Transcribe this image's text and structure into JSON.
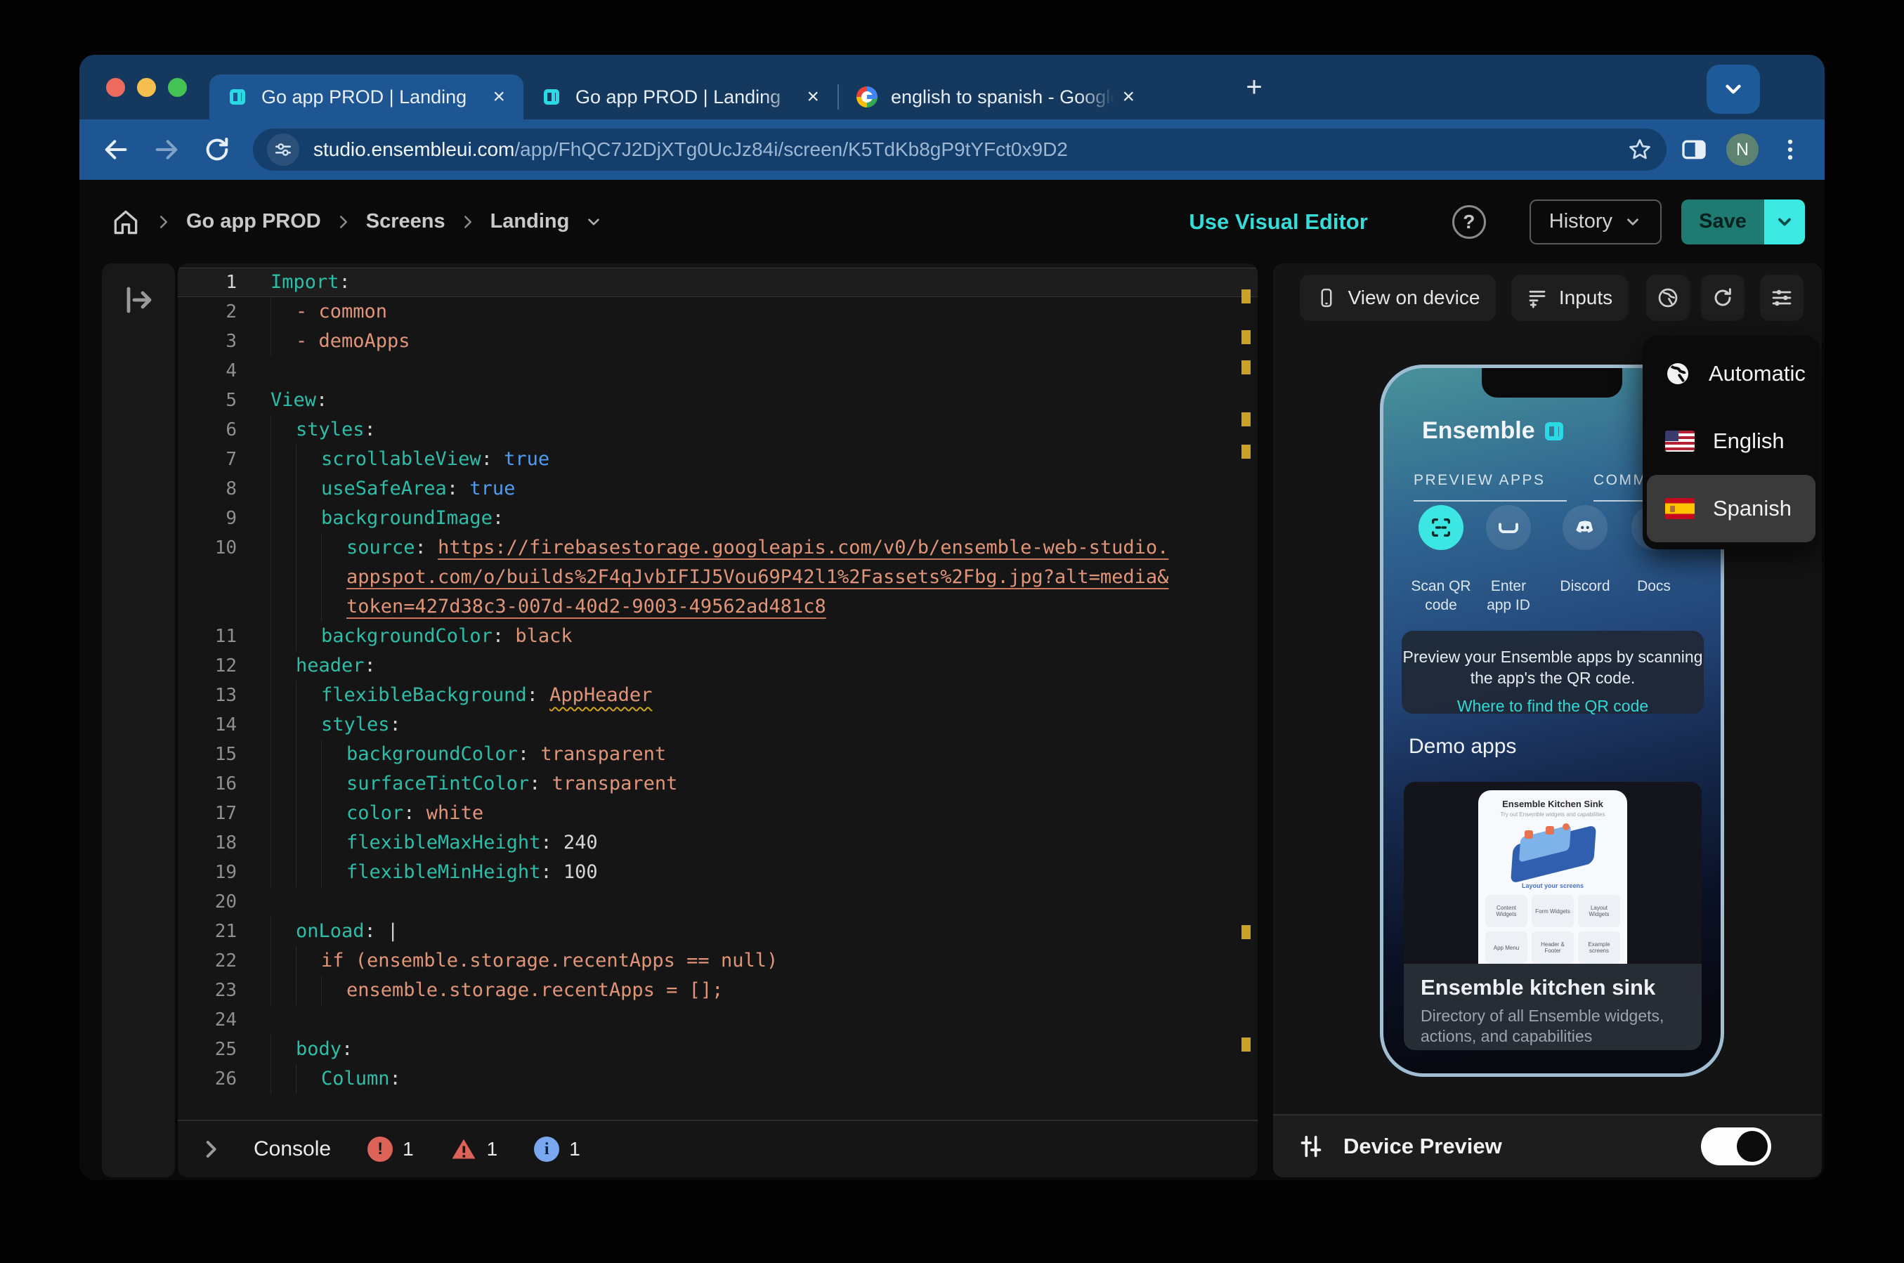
{
  "glyphs": {
    "close": "×",
    "new_tab": "+",
    "help": "?"
  },
  "browser": {
    "tabs": [
      {
        "title": "Go app PROD | Landing",
        "icon": "ensemble",
        "active": true
      },
      {
        "title": "Go app PROD | Landing",
        "icon": "ensemble",
        "active": false
      },
      {
        "title": "english to spanish - Google S",
        "icon": "google",
        "active": false
      }
    ],
    "url_host": "studio.ensembleui.com",
    "url_path": "/app/FhQC7J2DjXTg0UcJz84i/screen/K5TdKb8gP9tYFct0x9D2",
    "profile_initial": "N"
  },
  "app_header": {
    "breadcrumb": [
      "Go app PROD",
      "Screens",
      "Landing"
    ],
    "use_visual_editor": "Use Visual Editor",
    "history": "History",
    "save": "Save"
  },
  "editor": {
    "rows": [
      {
        "num": "1",
        "indent": 0,
        "current": true,
        "segs": [
          {
            "t": "Import",
            "c": "key"
          },
          {
            "t": ":",
            "c": "punc"
          }
        ]
      },
      {
        "num": "2",
        "indent": 1,
        "segs": [
          {
            "t": "- common",
            "c": "str"
          }
        ]
      },
      {
        "num": "3",
        "indent": 1,
        "segs": [
          {
            "t": "- demoApps",
            "c": "str"
          }
        ]
      },
      {
        "num": "4",
        "indent": 0,
        "segs": []
      },
      {
        "num": "5",
        "indent": 0,
        "segs": [
          {
            "t": "View",
            "c": "key"
          },
          {
            "t": ":",
            "c": "punc"
          }
        ]
      },
      {
        "num": "6",
        "indent": 1,
        "segs": [
          {
            "t": "styles",
            "c": "key"
          },
          {
            "t": ":",
            "c": "punc"
          }
        ]
      },
      {
        "num": "7",
        "indent": 2,
        "segs": [
          {
            "t": "scrollableView",
            "c": "key"
          },
          {
            "t": ": ",
            "c": "punc"
          },
          {
            "t": "true",
            "c": "bool"
          }
        ]
      },
      {
        "num": "8",
        "indent": 2,
        "segs": [
          {
            "t": "useSafeArea",
            "c": "key"
          },
          {
            "t": ": ",
            "c": "punc"
          },
          {
            "t": "true",
            "c": "bool"
          }
        ]
      },
      {
        "num": "9",
        "indent": 2,
        "segs": [
          {
            "t": "backgroundImage",
            "c": "key"
          },
          {
            "t": ":",
            "c": "punc"
          }
        ]
      },
      {
        "num": "10",
        "indent": 3,
        "segs": [
          {
            "t": "source",
            "c": "key"
          },
          {
            "t": ": ",
            "c": "punc"
          },
          {
            "t": "https://firebasestorage.googleapis.com/v0/b/ensemble-web-studio.",
            "c": "url"
          }
        ]
      },
      {
        "num": "",
        "indent": 3,
        "segs": [
          {
            "t": "appspot.com/o/builds%2F4qJvbIFIJ5Vou69P42l1%2Fassets%2Fbg.jpg?alt=media&",
            "c": "url"
          }
        ]
      },
      {
        "num": "",
        "indent": 3,
        "segs": [
          {
            "t": "token=427d38c3-007d-40d2-9003-49562ad481c8",
            "c": "url"
          }
        ]
      },
      {
        "num": "11",
        "indent": 2,
        "segs": [
          {
            "t": "backgroundColor",
            "c": "key"
          },
          {
            "t": ": ",
            "c": "punc"
          },
          {
            "t": "black",
            "c": "str"
          }
        ]
      },
      {
        "num": "12",
        "indent": 1,
        "segs": [
          {
            "t": "header",
            "c": "key"
          },
          {
            "t": ":",
            "c": "punc"
          }
        ]
      },
      {
        "num": "13",
        "indent": 2,
        "segs": [
          {
            "t": "flexibleBackground",
            "c": "key"
          },
          {
            "t": ": ",
            "c": "punc"
          },
          {
            "t": "AppHeader",
            "c": "str warn"
          }
        ]
      },
      {
        "num": "14",
        "indent": 2,
        "segs": [
          {
            "t": "styles",
            "c": "key"
          },
          {
            "t": ":",
            "c": "punc"
          }
        ]
      },
      {
        "num": "15",
        "indent": 3,
        "segs": [
          {
            "t": "backgroundColor",
            "c": "key"
          },
          {
            "t": ": ",
            "c": "punc"
          },
          {
            "t": "transparent",
            "c": "str"
          }
        ]
      },
      {
        "num": "16",
        "indent": 3,
        "segs": [
          {
            "t": "surfaceTintColor",
            "c": "key"
          },
          {
            "t": ": ",
            "c": "punc"
          },
          {
            "t": "transparent",
            "c": "str"
          }
        ]
      },
      {
        "num": "17",
        "indent": 3,
        "segs": [
          {
            "t": "color",
            "c": "key"
          },
          {
            "t": ": ",
            "c": "punc"
          },
          {
            "t": "white",
            "c": "str"
          }
        ]
      },
      {
        "num": "18",
        "indent": 3,
        "segs": [
          {
            "t": "flexibleMaxHeight",
            "c": "key"
          },
          {
            "t": ": ",
            "c": "punc"
          },
          {
            "t": "240",
            "c": "num"
          }
        ]
      },
      {
        "num": "19",
        "indent": 3,
        "segs": [
          {
            "t": "flexibleMinHeight",
            "c": "key"
          },
          {
            "t": ": ",
            "c": "punc"
          },
          {
            "t": "100",
            "c": "num"
          }
        ]
      },
      {
        "num": "20",
        "indent": 0,
        "segs": []
      },
      {
        "num": "21",
        "indent": 1,
        "segs": [
          {
            "t": "onLoad",
            "c": "key"
          },
          {
            "t": ": |",
            "c": "punc"
          }
        ]
      },
      {
        "num": "22",
        "indent": 2,
        "segs": [
          {
            "t": "if (ensemble.storage.recentApps == null)",
            "c": "str"
          }
        ]
      },
      {
        "num": "23",
        "indent": 3,
        "segs": [
          {
            "t": "ensemble.storage.recentApps = [];",
            "c": "str"
          }
        ]
      },
      {
        "num": "24",
        "indent": 0,
        "segs": []
      },
      {
        "num": "25",
        "indent": 1,
        "segs": [
          {
            "t": "body",
            "c": "key"
          },
          {
            "t": ":",
            "c": "punc"
          }
        ]
      },
      {
        "num": "26",
        "indent": 2,
        "segs": [
          {
            "t": "Column",
            "c": "key"
          },
          {
            "t": ":",
            "c": "punc"
          }
        ]
      }
    ],
    "markers_pct": [
      3.0,
      7.8,
      11.3,
      17.4,
      21.2,
      77.3,
      90.4
    ]
  },
  "console": {
    "label": "Console",
    "errors": "1",
    "warnings": "1",
    "infos": "1"
  },
  "preview": {
    "view_on_device": "View on device",
    "inputs": "Inputs",
    "language_menu": [
      {
        "label": "Automatic",
        "icon": "globe",
        "highlighted": false
      },
      {
        "label": "English",
        "icon": "flag-us",
        "highlighted": false
      },
      {
        "label": "Spanish",
        "icon": "flag-es",
        "highlighted": true
      }
    ],
    "phone": {
      "brand": "Ensemble",
      "section_left": "PREVIEW APPS",
      "section_right": "COMMUNITY &",
      "actions": [
        {
          "lines": [
            "Scan QR",
            "code"
          ],
          "icon": "qr-scan",
          "accent": true
        },
        {
          "lines": [
            "Enter",
            "app ID"
          ],
          "icon": "input-field",
          "accent": false
        },
        {
          "lines": [
            "Discord"
          ],
          "icon": "discord",
          "accent": false
        },
        {
          "lines": [
            "Docs"
          ],
          "icon": "docs",
          "accent": false
        }
      ],
      "info_text_line1": "Preview your Ensemble apps by scanning",
      "info_text_line2": "the app's the QR code.",
      "info_link": "Where to find the QR code",
      "demo_heading": "Demo apps",
      "demo_card": {
        "mock_title": "Ensemble Kitchen Sink",
        "mock_subtitle": "Try out Ensemble widgets and capabilities",
        "mock_section": "Layout your screens",
        "mock_tiles": [
          "Content Widgets",
          "Form Widgets",
          "Layout Widgets",
          "App Menu",
          "Header & Footer",
          "Example screens"
        ],
        "title": "Ensemble kitchen sink",
        "description": "Directory of all Ensemble widgets, actions, and capabilities"
      }
    },
    "device_preview": "Device Preview",
    "device_preview_on": true
  },
  "colors": {
    "accent_cyan": "#35E1DB",
    "save_teal": "#1F7A72",
    "error_red": "#DD6257",
    "info_blue": "#79A7F0",
    "marker_yellow": "#C9A227",
    "tab_strip": "#15395E",
    "toolbar_blue": "#1E5693"
  }
}
